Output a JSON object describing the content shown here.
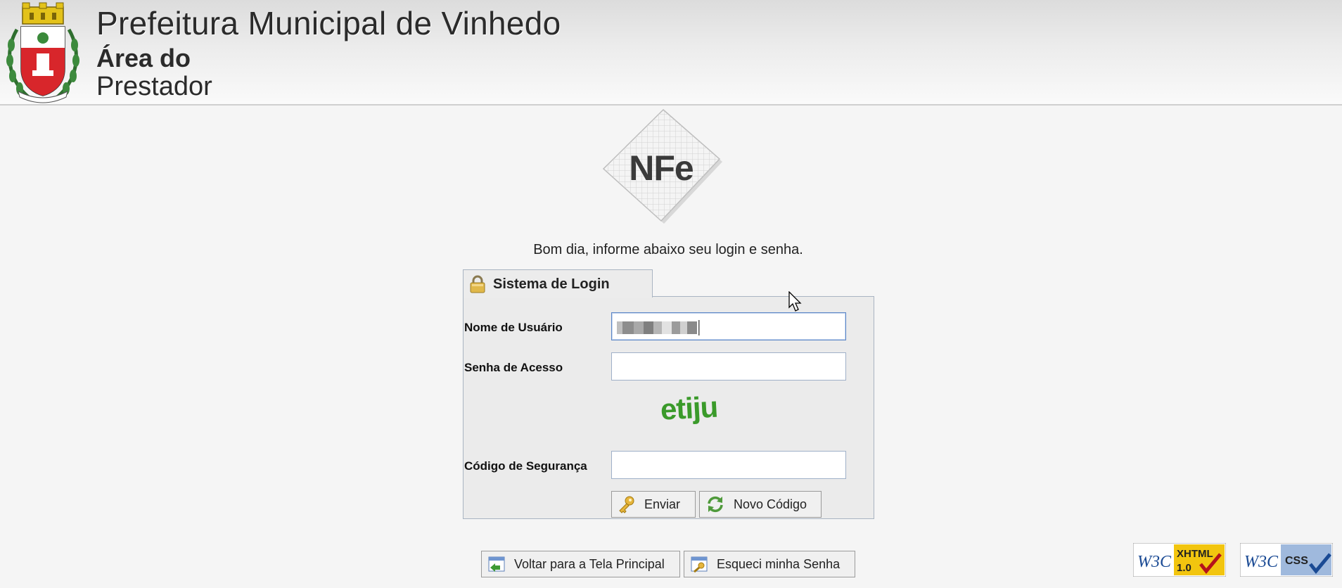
{
  "header": {
    "title": "Prefeitura Municipal de Vinhedo",
    "area_line1": "Área do",
    "area_line2": "Prestador"
  },
  "logo_text": "NFe",
  "greeting": "Bom dia, informe abaixo seu login e senha.",
  "login": {
    "tab_title": "Sistema de Login",
    "username_label": "Nome de Usuário",
    "username_value": "",
    "password_label": "Senha de Acesso",
    "password_value": "",
    "captcha_text": "etiju",
    "security_label": "Código de Segurança",
    "security_value": "",
    "submit_label": "Enviar",
    "new_code_label": "Novo Código"
  },
  "footer": {
    "back_label": "Voltar para a Tela Principal",
    "forgot_label": "Esqueci minha Senha",
    "badge_xhtml_line1": "XHTML",
    "badge_xhtml_line2": "1.0",
    "badge_css": "CSS",
    "badge_w3c": "W3C"
  },
  "colors": {
    "captcha_green": "#3a9a2a",
    "panel_border": "#a9b4c2",
    "focus_border": "#5b86c7",
    "badge_yellow": "#f2c50f",
    "badge_blue": "#9fb9dd"
  }
}
